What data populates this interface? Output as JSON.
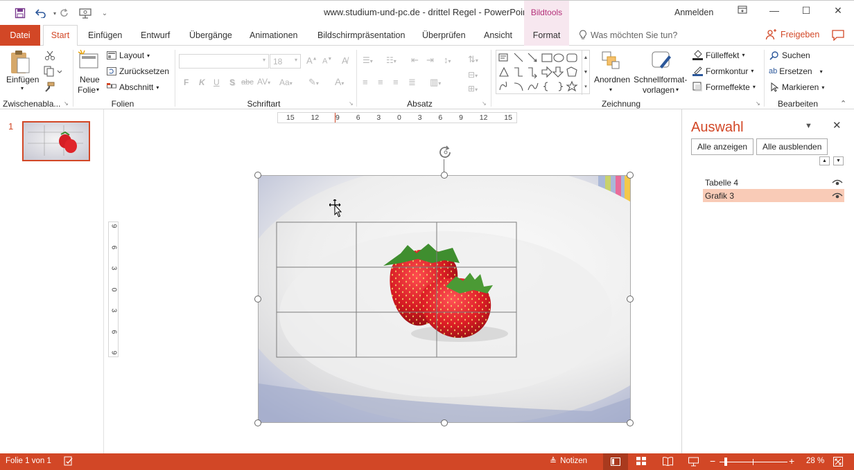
{
  "window": {
    "title": "www.studium-und-pc.de - drittel Regel  -  PowerPoint",
    "context_tab_group": "Bildtools",
    "account": "Anmelden"
  },
  "tabs": [
    "Datei",
    "Start",
    "Einfügen",
    "Entwurf",
    "Übergänge",
    "Animationen",
    "Bildschirmpräsentation",
    "Überprüfen",
    "Ansicht",
    "Format"
  ],
  "tell_me": "Was möchten Sie tun?",
  "share": "Freigeben",
  "ribbon": {
    "clipboard": {
      "paste": "Einfügen",
      "label": "Zwischenabla..."
    },
    "slides": {
      "new_slide_1": "Neue",
      "new_slide_2": "Folie",
      "layout": "Layout",
      "reset": "Zurücksetzen",
      "section": "Abschnitt",
      "label": "Folien"
    },
    "font": {
      "size": "18",
      "bold": "F",
      "italic": "K",
      "underline": "U",
      "shadow": "S",
      "strike": "abc",
      "spacing": "AV",
      "case": "Aa",
      "label": "Schriftart"
    },
    "paragraph": {
      "label": "Absatz"
    },
    "drawing": {
      "arrange": "Anordnen",
      "quick_styles_1": "Schnellformat-",
      "quick_styles_2": "vorlagen",
      "fill": "Fülleffekt",
      "outline": "Formkontur",
      "effects": "Formeffekte",
      "label": "Zeichnung"
    },
    "editing": {
      "find": "Suchen",
      "replace": "Ersetzen",
      "select": "Markieren",
      "label": "Bearbeiten"
    }
  },
  "slide_panel": {
    "slide_number": "1"
  },
  "ruler_h": [
    "15",
    "12",
    "9",
    "6",
    "3",
    "0",
    "3",
    "6",
    "9",
    "12",
    "15"
  ],
  "ruler_v": [
    "9",
    "6",
    "3",
    "0",
    "3",
    "6",
    "9"
  ],
  "selection_pane": {
    "title": "Auswahl",
    "show_all": "Alle anzeigen",
    "hide_all": "Alle ausblenden",
    "items": [
      {
        "name": "Tabelle 4",
        "selected": false
      },
      {
        "name": "Grafik 3",
        "selected": true
      }
    ]
  },
  "status": {
    "slide": "Folie 1 von 1",
    "notes": "Notizen",
    "zoom": "28 %"
  },
  "colors": {
    "accent": "#d24726",
    "context": "#b4317a",
    "selected_item": "#f9cbb7"
  }
}
